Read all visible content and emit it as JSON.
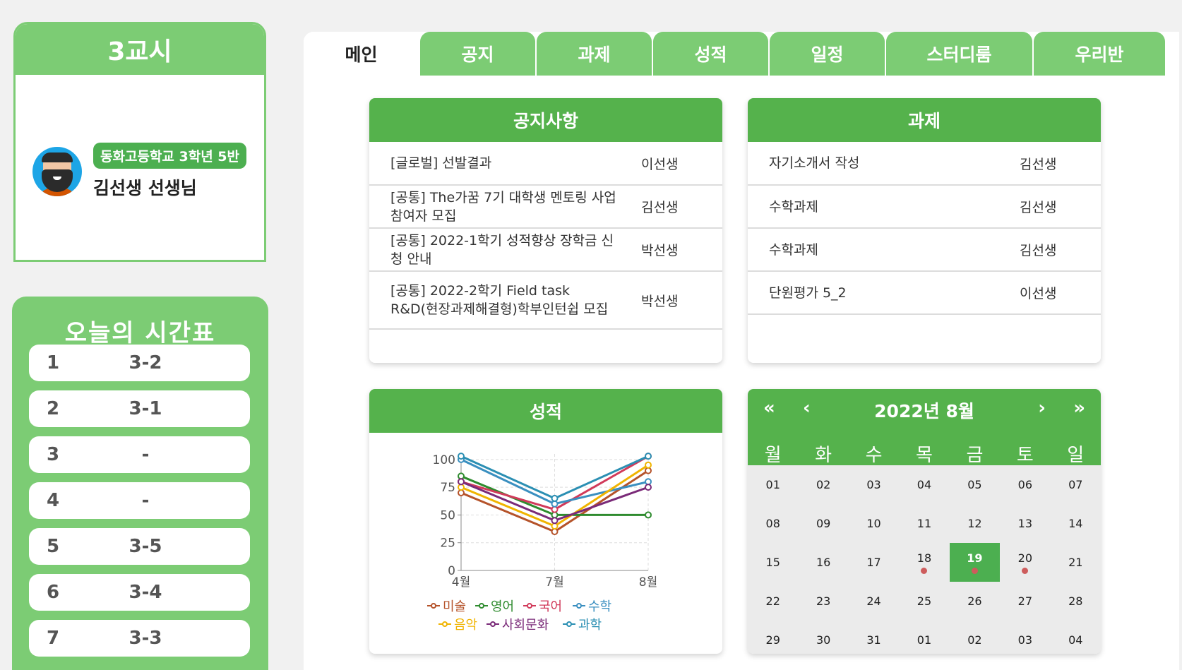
{
  "period": {
    "title": "3교시"
  },
  "profile": {
    "school": "동화고등학교 3학년 5반",
    "name": "김선생 선생님"
  },
  "timetable": {
    "title": "오늘의 시간표",
    "rows": [
      {
        "period": "1",
        "class": "3-2"
      },
      {
        "period": "2",
        "class": "3-1"
      },
      {
        "period": "3",
        "class": "-"
      },
      {
        "period": "4",
        "class": "-"
      },
      {
        "period": "5",
        "class": "3-5"
      },
      {
        "period": "6",
        "class": "3-4"
      },
      {
        "period": "7",
        "class": "3-3"
      }
    ]
  },
  "tabs": [
    "메인",
    "공지",
    "과제",
    "성적",
    "일정",
    "스터디룸",
    "우리반"
  ],
  "notice": {
    "title": "공지사항",
    "items": [
      {
        "title": "[글로벌] 선발결과",
        "writer": "이선생"
      },
      {
        "title": "[공통] The가꿈 7기 대학생 멘토링 사업 참여자 모집",
        "writer": "김선생"
      },
      {
        "title": "[공통] 2022-1학기 성적향상 장학금 신청 안내",
        "writer": "박선생"
      },
      {
        "title": "[공통] 2022-2학기 Field task R&D(현장과제해결형)학부인턴쉽 모집",
        "writer": "박선생"
      }
    ]
  },
  "assignments": {
    "title": "과제",
    "items": [
      {
        "title": "자기소개서 작성",
        "writer": "김선생"
      },
      {
        "title": "수학과제",
        "writer": "김선생"
      },
      {
        "title": "수학과제",
        "writer": "김선생"
      },
      {
        "title": "단원평가 5_2",
        "writer": "이선생"
      }
    ]
  },
  "grades": {
    "title": "성적"
  },
  "chart_data": {
    "type": "line",
    "categories": [
      "4월",
      "7월",
      "8월"
    ],
    "ylim": [
      0,
      105
    ],
    "yticks": [
      "0",
      "25",
      "50",
      "75",
      "100"
    ],
    "grid": true,
    "legend_position": "bottom",
    "series": [
      {
        "name": "미술",
        "color": "#b5532a",
        "values": [
          70,
          35,
          90
        ]
      },
      {
        "name": "영어",
        "color": "#2e8b2e",
        "values": [
          85,
          50,
          50
        ]
      },
      {
        "name": "국어",
        "color": "#d13a5a",
        "values": [
          80,
          55,
          103
        ]
      },
      {
        "name": "수학",
        "color": "#3a8fc0",
        "values": [
          100,
          60,
          80
        ]
      },
      {
        "name": "음악",
        "color": "#f0b400",
        "values": [
          75,
          40,
          95
        ]
      },
      {
        "name": "사회문화",
        "color": "#7a2a78",
        "values": [
          80,
          45,
          75
        ]
      },
      {
        "name": "과학",
        "color": "#2b8fb3",
        "values": [
          103,
          65,
          103
        ]
      }
    ]
  },
  "calendar": {
    "prev_year": "«",
    "prev_month": "‹",
    "next_month": "›",
    "next_year": "»",
    "title": "2022년 8월",
    "weekdays": [
      "월",
      "화",
      "수",
      "목",
      "금",
      "토",
      "일"
    ],
    "weeks": [
      [
        "01",
        "02",
        "03",
        "04",
        "05",
        "06",
        "07"
      ],
      [
        "08",
        "09",
        "10",
        "11",
        "12",
        "13",
        "14"
      ],
      [
        "15",
        "16",
        "17",
        "18",
        "19",
        "20",
        "21"
      ],
      [
        "22",
        "23",
        "24",
        "25",
        "26",
        "27",
        "28"
      ],
      [
        "29",
        "30",
        "31",
        "01",
        "02",
        "03",
        "04"
      ]
    ],
    "today": "19",
    "event_days": [
      "18",
      "19",
      "20"
    ]
  }
}
